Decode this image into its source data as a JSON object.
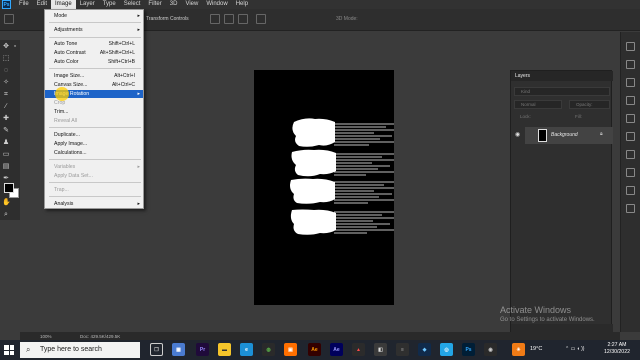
{
  "app": {
    "logo_text": "Ps"
  },
  "menubar": {
    "items": [
      "File",
      "Edit",
      "Image",
      "Layer",
      "Type",
      "Select",
      "Filter",
      "3D",
      "View",
      "Window",
      "Help"
    ],
    "active": "Image"
  },
  "options_bar": {
    "transform_label": "Transform Controls",
    "mode_3d_label": "3D Mode:"
  },
  "image_menu": {
    "items": [
      {
        "label": "Mode",
        "submenu": true
      },
      {
        "label": "Adjustments",
        "submenu": true
      },
      {
        "label": "Auto Tone",
        "shortcut": "Shift+Ctrl+L"
      },
      {
        "label": "Auto Contrast",
        "shortcut": "Alt+Shift+Ctrl+L"
      },
      {
        "label": "Auto Color",
        "shortcut": "Shift+Ctrl+B"
      },
      {
        "label": "Image Size...",
        "shortcut": "Alt+Ctrl+I"
      },
      {
        "label": "Canvas Size...",
        "shortcut": "Alt+Ctrl+C"
      },
      {
        "label": "Image Rotation",
        "submenu": true,
        "highlighted": true
      },
      {
        "label": "Crop",
        "disabled": true
      },
      {
        "label": "Trim..."
      },
      {
        "label": "Reveal All",
        "disabled": true
      },
      {
        "label": "Duplicate..."
      },
      {
        "label": "Apply Image..."
      },
      {
        "label": "Calculations..."
      },
      {
        "label": "Variables",
        "submenu": true,
        "disabled": true
      },
      {
        "label": "Apply Data Set...",
        "disabled": true
      },
      {
        "label": "Trap...",
        "disabled": true
      },
      {
        "label": "Analysis",
        "submenu": true
      }
    ]
  },
  "layers_panel": {
    "tab_label": "Layers",
    "kind_label": "Kind",
    "blend_mode": "Normal",
    "opacity_label": "Opacity:",
    "lock_label": "Lock:",
    "fill_label": "Fill:",
    "layer_name": "Background"
  },
  "status_bar": {
    "zoom": "100%",
    "doc": "Doc: 429.5K/429.5K"
  },
  "watermark": {
    "title": "Activate Windows",
    "subtitle": "Go to Settings to activate Windows."
  },
  "taskbar": {
    "search_placeholder": "Type here to search",
    "weather": "19°C",
    "time": "2:27 AM",
    "date": "12/30/2022"
  },
  "colors": {
    "menu_highlight": "#1e64c8",
    "panel_bg": "#2f2f2f",
    "canvas_bg": "#000000"
  }
}
